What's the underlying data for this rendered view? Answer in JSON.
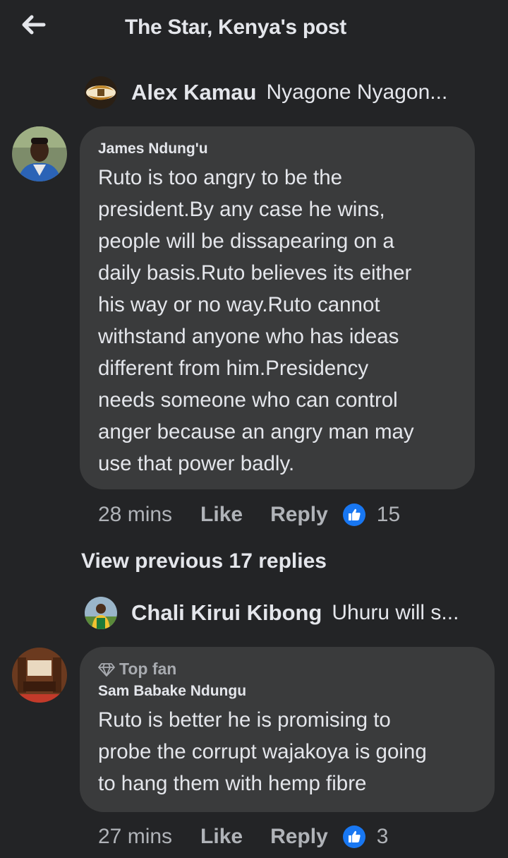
{
  "header": {
    "title": "The Star, Kenya's post",
    "back_icon": "arrow-left-icon"
  },
  "reply_preview_1": {
    "name": "Alex Kamau",
    "text": "Nyagone Nyagon..."
  },
  "comment_1": {
    "author": "James Ndung'u",
    "lines": [
      "Ruto is too angry to be the",
      "president.By any case he wins,",
      "people will be dissapearing on a",
      "daily basis.Ruto believes its either",
      "his way or no way.Ruto cannot",
      "withstand anyone who has ideas",
      "different from him.Presidency",
      "needs someone who can control",
      "anger because an angry man may",
      "use that power badly."
    ],
    "time": "28 mins",
    "like_label": "Like",
    "reply_label": "Reply",
    "reaction_count": "15"
  },
  "view_previous": "View previous 17 replies",
  "reply_preview_2": {
    "name": "Chali Kirui Kibong",
    "text": "Uhuru will s..."
  },
  "comment_2": {
    "badge": "Top fan",
    "author": "Sam Babake Ndungu",
    "lines": [
      "Ruto is better he is promising to",
      "probe the corrupt wajakoya is going",
      "to hang them with hemp fibre"
    ],
    "time": "27 mins",
    "like_label": "Like",
    "reply_label": "Reply",
    "reaction_count": "3"
  },
  "colors": {
    "background": "#232426",
    "bubble": "#3a3b3c",
    "text": "#e4e6eb",
    "secondary_text": "#b0b3b8",
    "like_blue": "#1877f2"
  }
}
